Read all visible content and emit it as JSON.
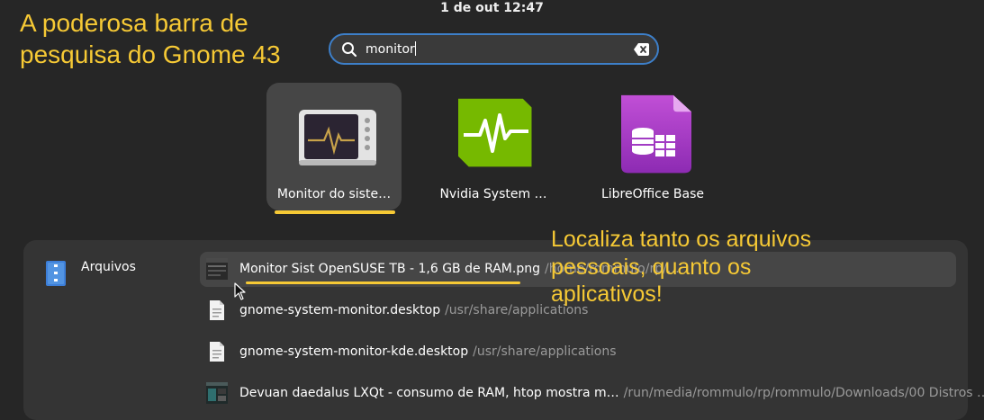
{
  "top_bar": {
    "clock": "1 de out  12:47"
  },
  "annotations": {
    "caption_top_left": "A poderosa barra de pesquisa do Gnome 43",
    "caption_files": "Localiza tanto os arquivos pessoais, quanto os aplicativos!",
    "highlight_color": "#f6c935"
  },
  "search": {
    "value": "monitor",
    "icon": "search-icon",
    "clear_icon": "clear-icon",
    "focus_color": "#3d7fc9"
  },
  "apps": [
    {
      "label": "Monitor do siste…",
      "icon": "system-monitor-icon",
      "selected": true
    },
    {
      "label": "Nvidia System …",
      "icon": "nvidia-monitor-icon",
      "selected": false
    },
    {
      "label": "LibreOffice Base",
      "icon": "libreoffice-base-icon",
      "selected": false
    }
  ],
  "files": {
    "provider": {
      "label": "Arquivos",
      "icon": "file-manager-icon"
    },
    "results": [
      {
        "name": "Monitor Sist OpenSUSE TB -  1,6 GB de RAM.png",
        "path": "/home/rommulo/rp/…",
        "icon": "image-thumbnail-icon",
        "highlighted": true
      },
      {
        "name": "gnome-system-monitor.desktop",
        "path": "/usr/share/applications",
        "icon": "text-file-icon",
        "highlighted": false
      },
      {
        "name": "gnome-system-monitor-kde.desktop",
        "path": "/usr/share/applications",
        "icon": "text-file-icon",
        "highlighted": false
      },
      {
        "name": "Devuan daedalus LXQt - consumo de RAM, htop mostra m…",
        "path": "/run/media/rommulo/rp/rommulo/Downloads/00 Distros …",
        "icon": "image-thumbnail-icon",
        "highlighted": false
      }
    ]
  }
}
